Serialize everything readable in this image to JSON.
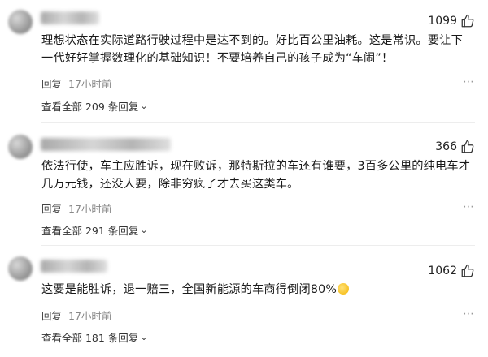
{
  "comments": [
    {
      "likes": "1099",
      "content": "理想状态在实际道路行驶过程中是达不到的。好比百公里油耗。这是常识。要让下一代好好掌握数理化的基础知识！不要培养自己的孩子成为“车闹”！",
      "reply": "回复",
      "time": "17小时前",
      "view_all": "查看全部 209 条回复"
    },
    {
      "likes": "366",
      "content": "依法行使，车主应胜诉，现在败诉，那特斯拉的车还有谁要，3百多公里的纯电车才几万元钱，还没人要，除非穷疯了才去买这类车。",
      "reply": "回复",
      "time": "17小时前",
      "view_all": "查看全部 291 条回复"
    },
    {
      "likes": "1062",
      "content": "这要是能胜诉，退一赔三，全国新能源的车商得倒闭80%",
      "reply": "回复",
      "time": "17小时前",
      "view_all": "查看全部 181 条回复"
    }
  ],
  "icons": {
    "like": "thumbs-up-icon",
    "more": "more-dots-icon",
    "expand": "chevron-down-icon",
    "emoji": "laughing-emoji-icon"
  }
}
